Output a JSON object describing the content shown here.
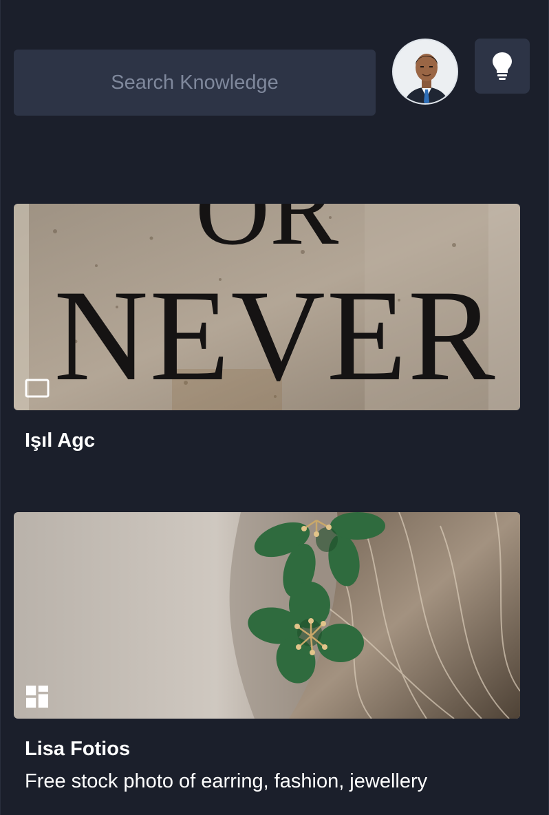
{
  "search": {
    "placeholder": "Search Knowledge"
  },
  "header": {
    "avatar_icon": "user-avatar",
    "idea_icon": "lightbulb-icon"
  },
  "cards": [
    {
      "author": "Işıl Agc",
      "description": "",
      "image_text": [
        "OR",
        "NEVER"
      ],
      "type_icon": "single-image-icon"
    },
    {
      "author": "Lisa Fotios",
      "description": "Free stock photo of earring, fashion, jewellery",
      "type_icon": "gallery-icon"
    }
  ],
  "colors": {
    "background": "#1b1f2b",
    "surface": "#2d3446",
    "text": "#ffffff",
    "placeholder": "#7f889c"
  }
}
